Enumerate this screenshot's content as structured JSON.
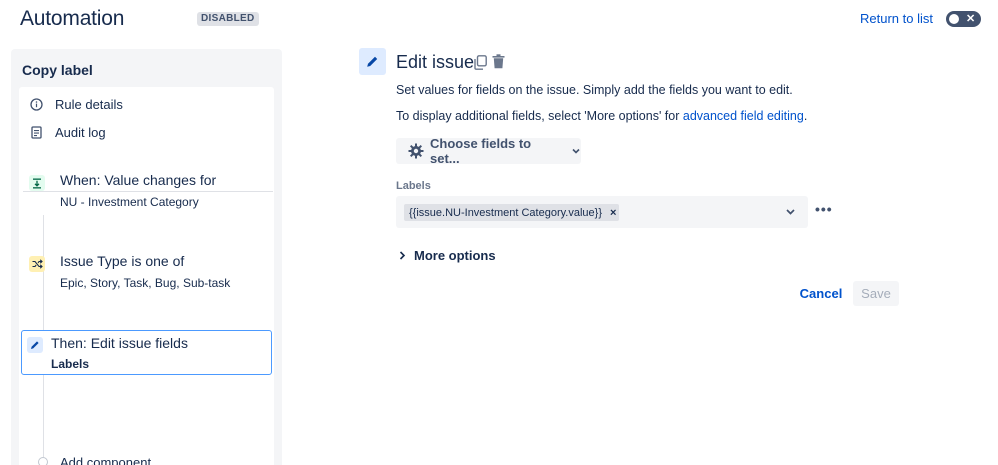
{
  "header": {
    "title": "Automation",
    "status_badge": "DISABLED",
    "return_link": "Return to list"
  },
  "sidebar": {
    "title": "Copy label",
    "nav": [
      {
        "label": "Rule details",
        "icon": "info-icon"
      },
      {
        "label": "Audit log",
        "icon": "document-icon"
      }
    ],
    "steps": [
      {
        "title": "When: Value changes for",
        "subtitle": "NU - Investment Category",
        "icon": "trigger-icon",
        "color": "#e3fcef"
      },
      {
        "title": "Issue Type is one of",
        "subtitle": "Epic, Story, Task, Bug, Sub-task",
        "icon": "condition-icon",
        "color": "#fff0b3"
      },
      {
        "title": "Then: Edit issue fields",
        "subtitle": "Labels",
        "icon": "pencil-icon",
        "color": "#deebff",
        "selected": true
      }
    ],
    "add_component": "Add component"
  },
  "main": {
    "title": "Edit issue",
    "description": "Set values for fields on the issue. Simply add the fields you want to edit.",
    "more_info_prefix": "To display additional fields, select 'More options' for ",
    "more_info_link": "advanced field editing",
    "more_info_suffix": ".",
    "choose_fields_label": "Choose fields to set...",
    "field": {
      "label": "Labels",
      "tag_value": "{{issue.NU-Investment Category.value}}",
      "tag_remove": "×"
    },
    "more_options_label": "More options",
    "cancel_label": "Cancel",
    "save_label": "Save"
  },
  "colors": {
    "accent": "#0052cc",
    "selection_border": "#4c9aff",
    "toggle_off": "#42526e"
  }
}
